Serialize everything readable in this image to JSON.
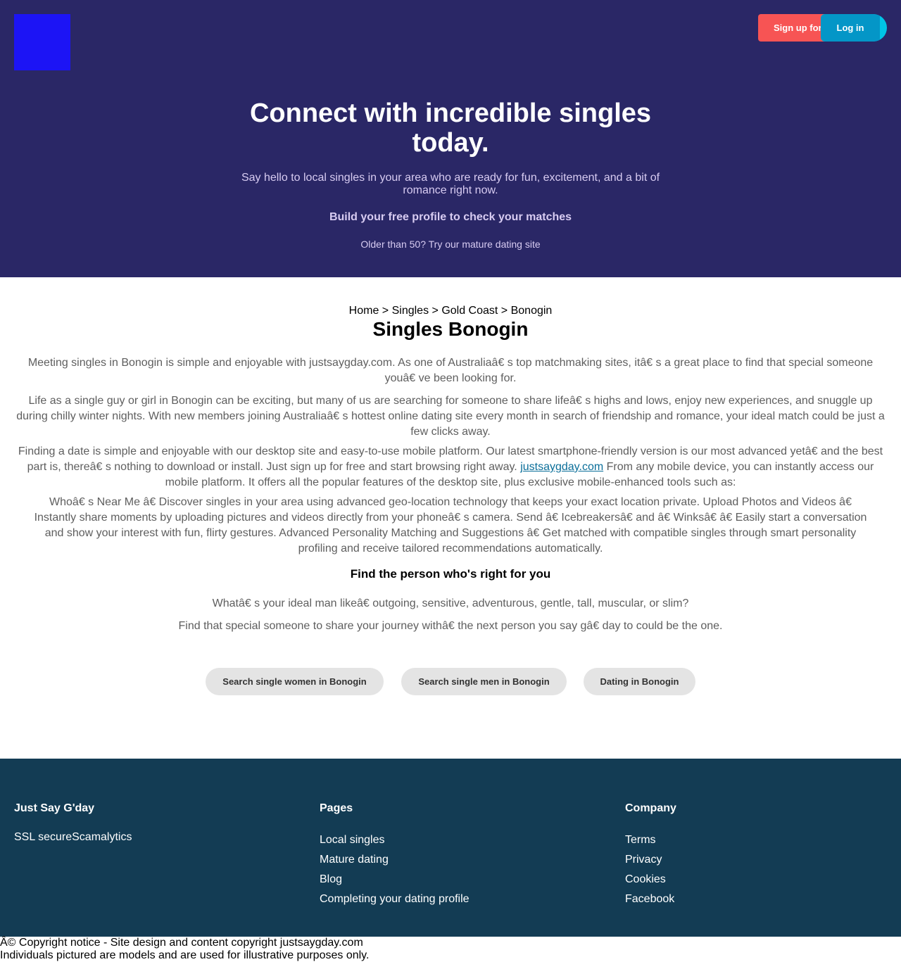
{
  "header": {
    "signup_label": "Sign up for free",
    "login_label": "Log in"
  },
  "hero": {
    "title": "Connect with incredible singles today.",
    "subtitle": "Say hello to local singles in your area who are ready for fun, excitement, and a bit of romance right now.",
    "cta": "Build your free profile to check your matches",
    "mature_link": "Older than 50? Try our mature dating site"
  },
  "breadcrumb": {
    "home": "Home",
    "sep": " > ",
    "singles": "Singles",
    "region": "Gold Coast",
    "current": "Bonogin"
  },
  "main": {
    "title": "Singles Bonogin",
    "p1": "Meeting singles in Bonogin is simple and enjoyable with justsaygday.com. As one of Australiaâ€ s top matchmaking sites, itâ€ s a great place to find that special someone youâ€ ve been looking for.",
    "p2": "Life as a single guy or girl in Bonogin can be exciting, but many of us are searching for someone to share lifeâ€ s highs and lows, enjoy new experiences, and snuggle up during chilly winter nights. With new members joining Australiaâ€ s hottest online dating site every month in search of friendship and romance, your ideal match could be just a few clicks away.",
    "p3_before": "Finding a date is simple and enjoyable with our desktop site and easy-to-use mobile platform. Our latest smartphone-friendly version is our most advanced yetâ€  and the best part is, thereâ€ s nothing to download or install. Just sign up for free and start browsing right away. ",
    "p3_link": "justsaygday.com",
    "p3_after": " From any mobile device, you can instantly access our mobile platform. It offers all the popular features of the desktop site, plus exclusive mobile-enhanced tools such as:",
    "p4": "Whoâ€ s Near Me â€  Discover singles in your area using advanced geo-location technology that keeps your exact location private. Upload Photos and Videos â€  Instantly share moments by uploading pictures and videos directly from your phoneâ€ s camera. Send â€ Icebreakersâ€  and â€ Winksâ€  â€  Easily start a conversation and show your interest with fun, flirty gestures. Advanced Personality Matching and Suggestions â€  Get matched with compatible singles through smart personality profiling and receive tailored recommendations automatically.",
    "find_title": "Find the person who's right for you",
    "p5": "Whatâ€ s your ideal man likeâ€ outgoing, sensitive, adventurous, gentle, tall, muscular, or slim?",
    "p6": "Find that special someone to share your journey withâ€ the next person you say gâ€ day to could be the one.",
    "pills": {
      "women": "Search single women in Bonogin",
      "men": "Search single men in Bonogin",
      "dating": "Dating in Bonogin"
    }
  },
  "footer": {
    "col1": {
      "title": "Just Say G'day",
      "badges": "SSL secureScamalytics"
    },
    "col2": {
      "title": "Pages",
      "items": [
        "Local singles",
        "Mature dating",
        "Blog",
        "Completing your dating profile"
      ]
    },
    "col3": {
      "title": "Company",
      "items": [
        "Terms",
        "Privacy",
        "Cookies",
        "Facebook"
      ]
    }
  },
  "copyright": {
    "line1": "Â© Copyright notice - Site design and content copyright justsaygday.com",
    "line2": "Individuals pictured are models and are used for illustrative purposes only."
  }
}
